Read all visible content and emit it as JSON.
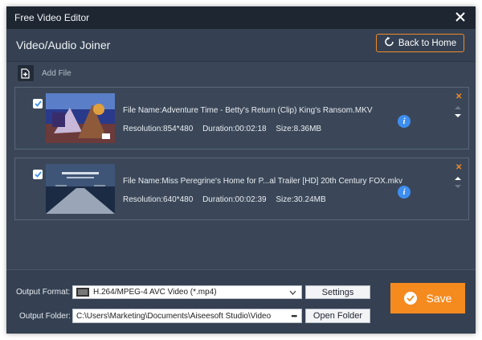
{
  "window": {
    "title": "Free Video Editor"
  },
  "header": {
    "section_title": "Video/Audio Joiner",
    "back_label": "Back to Home"
  },
  "toolbar": {
    "add_file_label": "Add File"
  },
  "files": [
    {
      "checked": true,
      "name": "File Name:Adventure Time - Betty's Return (Clip) King's Ransom.MKV",
      "resolution": "Resolution:854*480",
      "duration": "Duration:00:02:18",
      "size": "Size:8.36MB"
    },
    {
      "checked": true,
      "name": "File Name:Miss Peregrine's Home for P...al Trailer [HD]  20th Century FOX.mkv",
      "resolution": "Resolution:640*480",
      "duration": "Duration:00:02:39",
      "size": "Size:30.24MB"
    }
  ],
  "footer": {
    "output_format_label": "Output Format:",
    "output_format_value": "H.264/MPEG-4 AVC Video (*.mp4)",
    "settings_label": "Settings",
    "output_folder_label": "Output Folder:",
    "output_folder_value": "C:\\Users\\Marketing\\Documents\\Aiseesoft Studio\\Video",
    "browse_label": "•••",
    "open_folder_label": "Open Folder",
    "save_label": "Save"
  },
  "icons": {
    "close": "close-icon",
    "back": "back-arrow-icon",
    "add_file": "add-file-icon",
    "info": "info-icon",
    "delete": "delete-icon",
    "move_up": "move-up-icon",
    "move_down": "move-down-icon",
    "dropdown": "chevron-down-icon",
    "save": "checkmark-icon"
  },
  "colors": {
    "accent": "#f08a2a",
    "save": "#f58a1f",
    "info": "#3d8ef0",
    "window_bg": "#3a4657",
    "titlebar_bg": "#1e2631"
  }
}
